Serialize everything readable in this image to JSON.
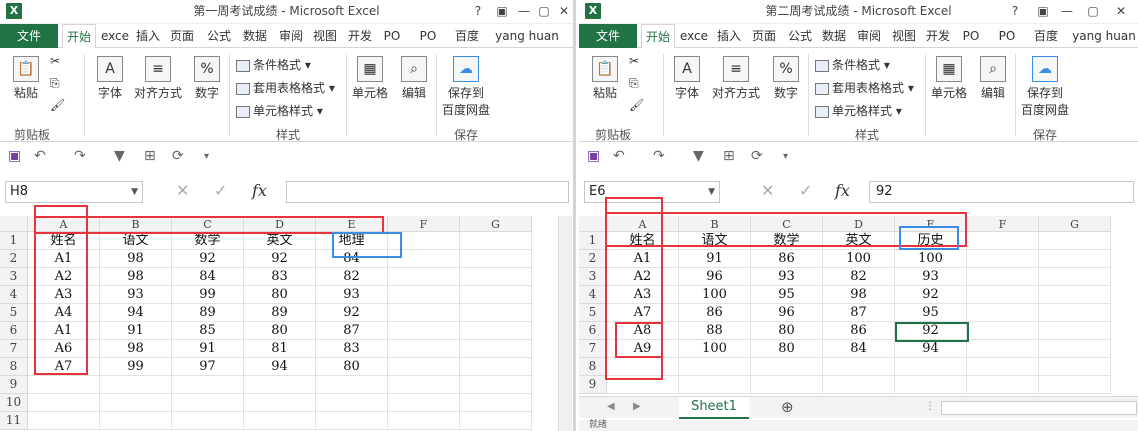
{
  "windows": [
    {
      "title": "第一周考试成绩 - Microsoft Excel",
      "title_controls": [
        "?",
        "▣",
        "—",
        "▢",
        "✕"
      ],
      "tabs": [
        "文件",
        "开始",
        "exce",
        "插入",
        "页面",
        "公式",
        "数据",
        "审阅",
        "视图",
        "开发",
        "PO",
        "PO",
        "百度",
        "yang huan"
      ],
      "ribbon": {
        "paste": "粘贴",
        "clipboard": "剪贴板",
        "font": "字体",
        "align": "对齐方式",
        "number": "数字",
        "cond_format": "条件格式",
        "table_format": "套用表格格式",
        "cell_style": "单元格样式",
        "styles": "样式",
        "cells": "单元格",
        "edit": "编辑",
        "save_to": "保存到",
        "baidu_disk": "百度网盘",
        "save": "保存"
      },
      "name_box": "H8",
      "formula": "",
      "columns": [
        "A",
        "B",
        "C",
        "D",
        "E",
        "F",
        "G"
      ],
      "rows": [
        [
          "姓名",
          "语文",
          "数学",
          "英文",
          "地理",
          "",
          ""
        ],
        [
          "A1",
          "98",
          "92",
          "92",
          "84",
          "",
          ""
        ],
        [
          "A2",
          "98",
          "84",
          "83",
          "82",
          "",
          ""
        ],
        [
          "A3",
          "93",
          "99",
          "80",
          "93",
          "",
          ""
        ],
        [
          "A4",
          "94",
          "89",
          "89",
          "92",
          "",
          ""
        ],
        [
          "A1",
          "91",
          "85",
          "80",
          "87",
          "",
          ""
        ],
        [
          "A6",
          "98",
          "91",
          "81",
          "83",
          "",
          ""
        ],
        [
          "A7",
          "99",
          "97",
          "94",
          "80",
          "",
          ""
        ],
        [
          "",
          "",
          "",
          "",
          "",
          "",
          ""
        ],
        [
          "",
          "",
          "",
          "",
          "",
          "",
          ""
        ],
        [
          "",
          "",
          "",
          "",
          "",
          "",
          ""
        ]
      ],
      "row_numbers": [
        "1",
        "2",
        "3",
        "4",
        "5",
        "6",
        "7",
        "8",
        "9",
        "10",
        "11"
      ]
    },
    {
      "title": "第二周考试成绩 - Microsoft Excel",
      "title_controls": [
        "?",
        "▣",
        "—",
        "▢",
        "✕"
      ],
      "tabs": [
        "文件",
        "开始",
        "exce",
        "插入",
        "页面",
        "公式",
        "数据",
        "审阅",
        "视图",
        "开发",
        "PO",
        "PO",
        "百度",
        "yang huan"
      ],
      "ribbon": {
        "paste": "粘贴",
        "clipboard": "剪贴板",
        "font": "字体",
        "align": "对齐方式",
        "number": "数字",
        "cond_format": "条件格式",
        "table_format": "套用表格格式",
        "cell_style": "单元格样式",
        "styles": "样式",
        "cells": "单元格",
        "edit": "编辑",
        "save_to": "保存到",
        "baidu_disk": "百度网盘",
        "save": "保存"
      },
      "name_box": "E6",
      "formula": "92",
      "columns": [
        "A",
        "B",
        "C",
        "D",
        "E",
        "F",
        "G"
      ],
      "rows": [
        [
          "姓名",
          "语文",
          "数学",
          "英文",
          "历史",
          "",
          ""
        ],
        [
          "A1",
          "91",
          "86",
          "100",
          "100",
          "",
          ""
        ],
        [
          "A2",
          "96",
          "93",
          "82",
          "93",
          "",
          ""
        ],
        [
          "A3",
          "100",
          "95",
          "98",
          "92",
          "",
          ""
        ],
        [
          "A7",
          "86",
          "96",
          "87",
          "95",
          "",
          ""
        ],
        [
          "A8",
          "88",
          "80",
          "86",
          "92",
          "",
          ""
        ],
        [
          "A9",
          "100",
          "80",
          "84",
          "94",
          "",
          ""
        ],
        [
          "",
          "",
          "",
          "",
          "",
          "",
          ""
        ],
        [
          "",
          "",
          "",
          "",
          "",
          "",
          ""
        ]
      ],
      "row_numbers": [
        "1",
        "2",
        "3",
        "4",
        "5",
        "6",
        "7",
        "8",
        "9"
      ],
      "sheet_tab": "Sheet1",
      "add_sheet": "⊕",
      "status_text": "就绪"
    }
  ],
  "colors": {
    "accent": "#217346",
    "highlight_red": "#e8323c",
    "highlight_blue": "#3b8ee6"
  }
}
